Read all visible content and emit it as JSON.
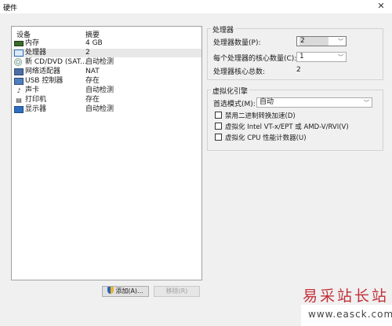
{
  "window": {
    "title": "硬件",
    "close_glyph": "✕"
  },
  "device_list": {
    "headers": {
      "device": "设备",
      "summary": "摘要"
    },
    "rows": [
      {
        "icon": "memory-icon",
        "name": "内存",
        "summary": "4 GB"
      },
      {
        "icon": "processor-icon",
        "name": "处理器",
        "summary": "2"
      },
      {
        "icon": "cd-dvd-icon",
        "name": "新 CD/DVD (SAT...",
        "summary": "自动检测"
      },
      {
        "icon": "network-adapter-icon",
        "name": "网络适配器",
        "summary": "NAT"
      },
      {
        "icon": "usb-controller-icon",
        "name": "USB 控制器",
        "summary": "存在"
      },
      {
        "icon": "sound-card-icon",
        "name": "声卡",
        "summary": "自动检测"
      },
      {
        "icon": "printer-icon",
        "name": "打印机",
        "summary": "存在"
      },
      {
        "icon": "display-icon",
        "name": "显示器",
        "summary": "自动检测"
      }
    ]
  },
  "buttons": {
    "add": "添加(A)...",
    "remove": "移除(R)"
  },
  "processor_group": {
    "title": "处理器",
    "count_label": "处理器数量(P):",
    "count_value": "2",
    "cores_label": "每个处理器的核心数量(C):",
    "cores_value": "1",
    "total_label": "处理器核心总数:",
    "total_value": "2"
  },
  "virtualization_group": {
    "title": "虚拟化引擎",
    "mode_label": "首选模式(M):",
    "mode_value": "自动",
    "options": [
      "禁用二进制转换加速(D)",
      "虚拟化 Intel VT-x/EPT 或 AMD-V/RVI(V)",
      "虚拟化 CPU 性能计数器(U)"
    ]
  },
  "watermark": {
    "text": "易采站长站",
    "url": "www.easck.com"
  }
}
